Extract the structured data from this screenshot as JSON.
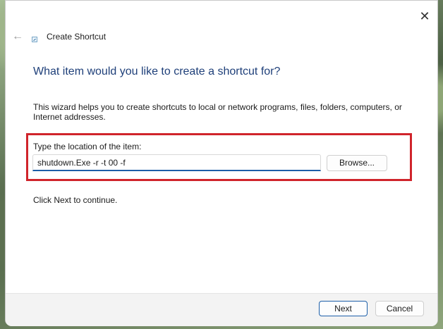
{
  "wizard": {
    "title": "Create Shortcut",
    "heading": "What item would you like to create a shortcut for?",
    "description": "This wizard helps you to create shortcuts to local or network programs, files, folders, computers, or Internet addresses.",
    "location_label": "Type the location of the item:",
    "location_value": "shutdown.Exe -r -t 00 -f",
    "browse_label": "Browse...",
    "continue_text": "Click Next to continue.",
    "next_label": "Next",
    "cancel_label": "Cancel"
  },
  "icons": {
    "close": "close-icon",
    "back": "back-arrow-icon",
    "wizard": "shortcut-wizard-icon"
  },
  "colors": {
    "heading": "#1e3f79",
    "highlight_border": "#d0242b",
    "input_underline": "#1c5ea8",
    "primary_button_border": "#1c5ea8"
  }
}
